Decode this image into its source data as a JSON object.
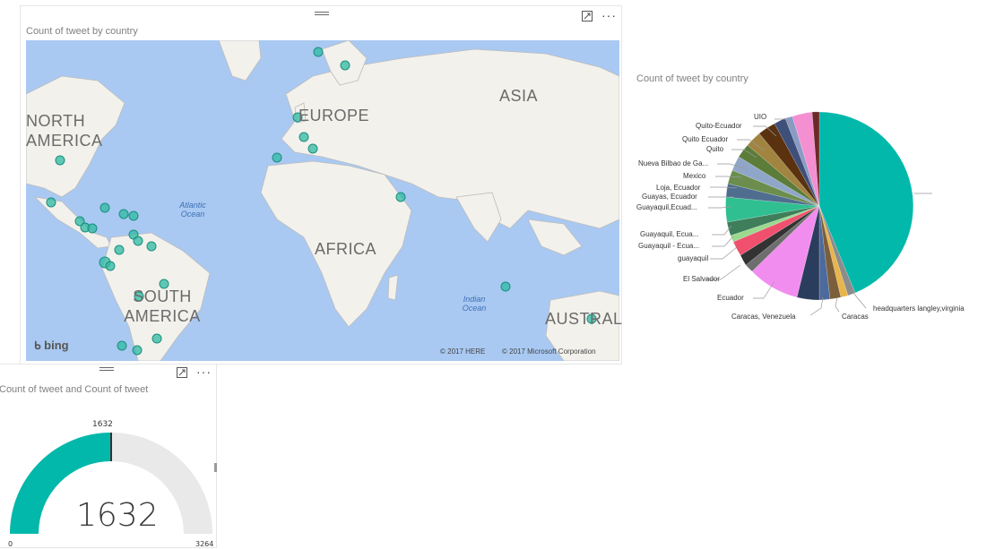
{
  "map": {
    "title": "Count of tweet by country",
    "regions": [
      "NORTH AMERICA",
      "EUROPE",
      "ASIA",
      "AFRICA",
      "SOUTH AMERICA",
      "AUSTRAL"
    ],
    "oceans": {
      "atlantic": "Atlantic Ocean",
      "indian": "Indian Ocean"
    },
    "bing_label": "bing",
    "copyright_here": "© 2017 HERE",
    "copyright_ms": "© 2017 Microsoft Corporation",
    "colors": {
      "water": "#a9c9f2",
      "land": "#f3f1ec",
      "border": "#bcbcbc",
      "dot": "#2fb8a3"
    }
  },
  "pie": {
    "title": "Count of tweet by country",
    "labels": [
      "UIO",
      "Quito-Ecuador",
      "Quito Ecuador",
      "Quito",
      "Nueva Bilbao de Ga...",
      "Mexico",
      "Loja, Ecuador",
      "Guayas, Ecuador",
      "Guayaquil,Ecuad...",
      "Guayaquil, Ecua...",
      "Guayaquil - Ecua...",
      "guayaquil",
      "El Salvador",
      "Ecuador",
      "Caracas, Venezuela",
      "Caracas",
      "headquarters langley,virginia"
    ],
    "big_slice_color": "#01b8aa"
  },
  "gauge": {
    "title": "Count of tweet and Count of tweet",
    "value": "1632",
    "target_label": "1632",
    "min": "0",
    "max": "3264",
    "fraction": 0.5,
    "colors": {
      "fill": "#01b8aa",
      "track": "#e9e9e9"
    }
  },
  "icons": {
    "focus": "focus-mode-icon",
    "more": "more-options-icon",
    "grip": "drag-handle-icon"
  }
}
